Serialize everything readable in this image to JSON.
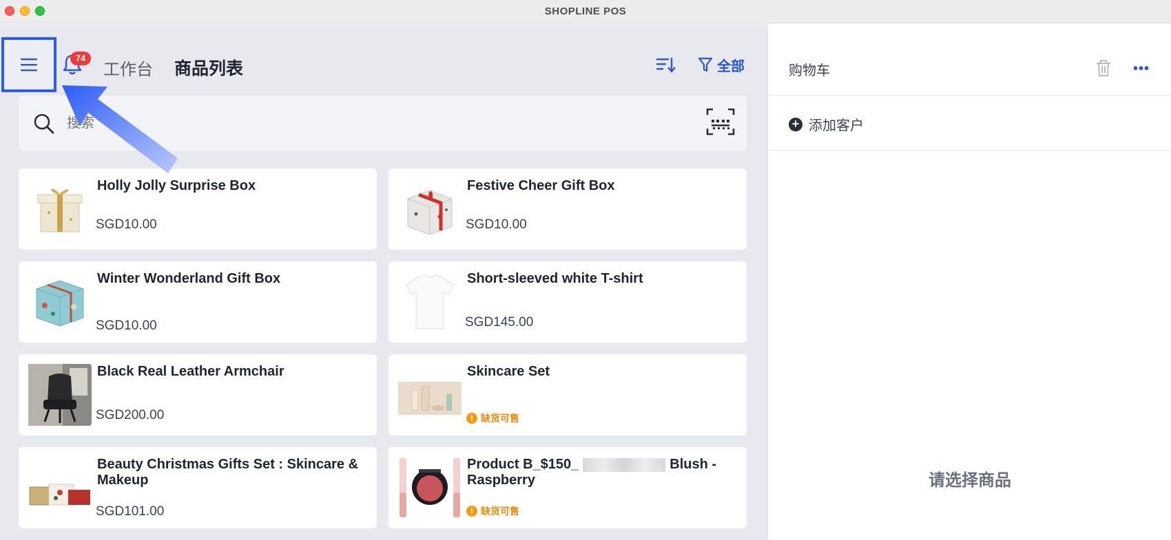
{
  "window": {
    "title": "SHOPLINE POS"
  },
  "header": {
    "notification_count": "74",
    "tab_workbench": "工作台",
    "tab_products": "商品列表",
    "filter_label": "全部"
  },
  "search": {
    "placeholder": "搜索",
    "value": ""
  },
  "products": [
    {
      "name": "Holly Jolly Surprise Box",
      "price": "SGD10.00",
      "status": ""
    },
    {
      "name": "Festive Cheer Gift Box",
      "price": "SGD10.00",
      "status": ""
    },
    {
      "name": "Winter Wonderland Gift Box",
      "price": "SGD10.00",
      "status": ""
    },
    {
      "name": "Short-sleeved white T-shirt",
      "price": "SGD145.00",
      "status": ""
    },
    {
      "name": "Black Real Leather Armchair",
      "price": "SGD200.00",
      "status": ""
    },
    {
      "name": "Skincare Set",
      "price": "",
      "status": "缺货可售"
    },
    {
      "name": "Beauty Christmas Gifts Set : Skincare & Makeup",
      "price": "SGD101.00",
      "status": ""
    },
    {
      "name_prefix": "Product B_$150_",
      "name_suffix": "Blush - Raspberry",
      "price": "",
      "status": "缺货可售"
    }
  ],
  "cart": {
    "title": "购物车",
    "more": "•••",
    "add_customer": "添加客户",
    "empty_message": "请选择商品"
  },
  "icons": {
    "menu": "hamburger-icon",
    "notification": "bell-icon",
    "sort": "sort-icon",
    "filter": "filter-icon",
    "search": "search-icon",
    "scan": "barcode-scan-icon",
    "trash": "trash-icon"
  },
  "colors": {
    "accent": "#2756d9",
    "badge": "#f03a3a",
    "warning": "#f08a0c",
    "highlight_box": "#2a5cf5"
  }
}
